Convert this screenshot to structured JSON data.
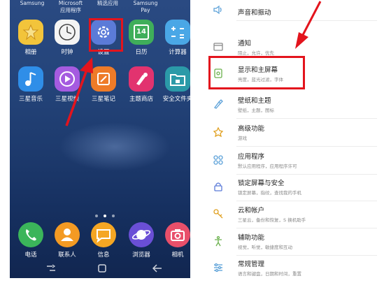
{
  "home": {
    "top_labels": [
      "Samsung",
      "Microsoft\n应用程序",
      "精选应用",
      "Samsung\nPay"
    ],
    "row1": [
      "相册",
      "时钟",
      "设置",
      "日历",
      "计算器"
    ],
    "calendar_day": "14",
    "row2": [
      "三星音乐",
      "三星视频",
      "三星笔记",
      "主题商店",
      "安全文件夹"
    ],
    "dock": [
      "电话",
      "联系人",
      "信息",
      "浏览器",
      "相机"
    ]
  },
  "settings": {
    "items": [
      {
        "title": "声音和振动",
        "subtitle": ""
      },
      {
        "title": "通知",
        "subtitle": "阻止，允许，优先"
      },
      {
        "title": "显示和主屏幕",
        "subtitle": "亮度，蓝光过滤，字体"
      },
      {
        "title": "壁纸和主题",
        "subtitle": "壁纸，主题，图标"
      },
      {
        "title": "高级功能",
        "subtitle": "游戏"
      },
      {
        "title": "应用程序",
        "subtitle": "默认应用程序，应用程序许可"
      },
      {
        "title": "锁定屏幕与安全",
        "subtitle": "锁定屏幕，指纹，查找我的手机"
      },
      {
        "title": "云和帐户",
        "subtitle": "三星云，备份和恢复，S 换机助手"
      },
      {
        "title": "辅助功能",
        "subtitle": "视觉，听觉，敏捷度和互动"
      },
      {
        "title": "常规管理",
        "subtitle": "语言和键盘，日期和时间，重置"
      }
    ]
  },
  "colors": {
    "highlight": "#e3141d"
  }
}
